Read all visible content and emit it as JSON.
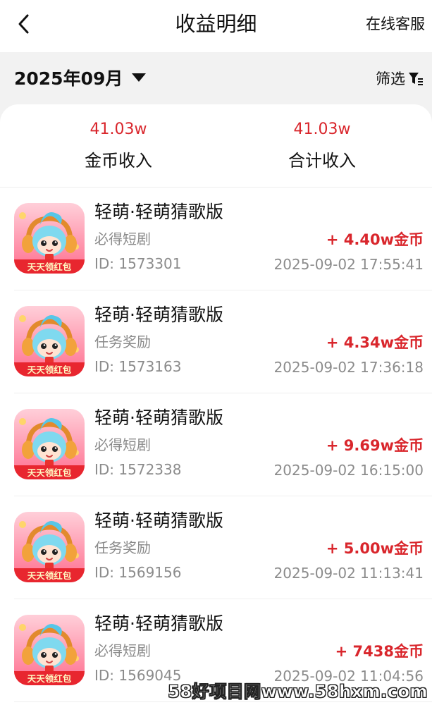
{
  "header": {
    "title": "收益明细",
    "support_label": "在线客服"
  },
  "filter_bar": {
    "month": "2025年09月",
    "filter_label": "筛选"
  },
  "summary": {
    "coin_income_value": "41.03w",
    "coin_income_label": "金币收入",
    "total_income_value": "41.03w",
    "total_income_label": "合计收入"
  },
  "records": [
    {
      "app_name": "轻萌·轻萌猜歌版",
      "type": "必得短剧",
      "id": "ID: 1573301",
      "amount": "+ 4.40w金币",
      "time": "2025-09-02 17:55:41",
      "icon_banner": "天天领红包"
    },
    {
      "app_name": "轻萌·轻萌猜歌版",
      "type": "任务奖励",
      "id": "ID: 1573163",
      "amount": "+ 4.34w金币",
      "time": "2025-09-02 17:36:18",
      "icon_banner": "天天领红包"
    },
    {
      "app_name": "轻萌·轻萌猜歌版",
      "type": "必得短剧",
      "id": "ID: 1572338",
      "amount": "+ 9.69w金币",
      "time": "2025-09-02 16:15:00",
      "icon_banner": "天天领红包"
    },
    {
      "app_name": "轻萌·轻萌猜歌版",
      "type": "任务奖励",
      "id": "ID: 1569156",
      "amount": "+ 5.00w金币",
      "time": "2025-09-02 11:13:41",
      "icon_banner": "天天领红包"
    },
    {
      "app_name": "轻萌·轻萌猜歌版",
      "type": "必得短剧",
      "id": "ID: 1569045",
      "amount": "+ 7438金币",
      "time": "2025-09-02 11:04:56",
      "icon_banner": "天天领红包"
    }
  ],
  "watermark": "58好项目网www.58hxm.com",
  "colors": {
    "accent_red": "#d9262c",
    "secondary_text": "#8b8b8b",
    "page_background": "#f2f2f2"
  },
  "icons": {
    "back": "chevron-left-icon",
    "month_dropdown": "caret-down-icon",
    "filter": "filter-funnel-icon",
    "app": "app-mascot-icon"
  }
}
